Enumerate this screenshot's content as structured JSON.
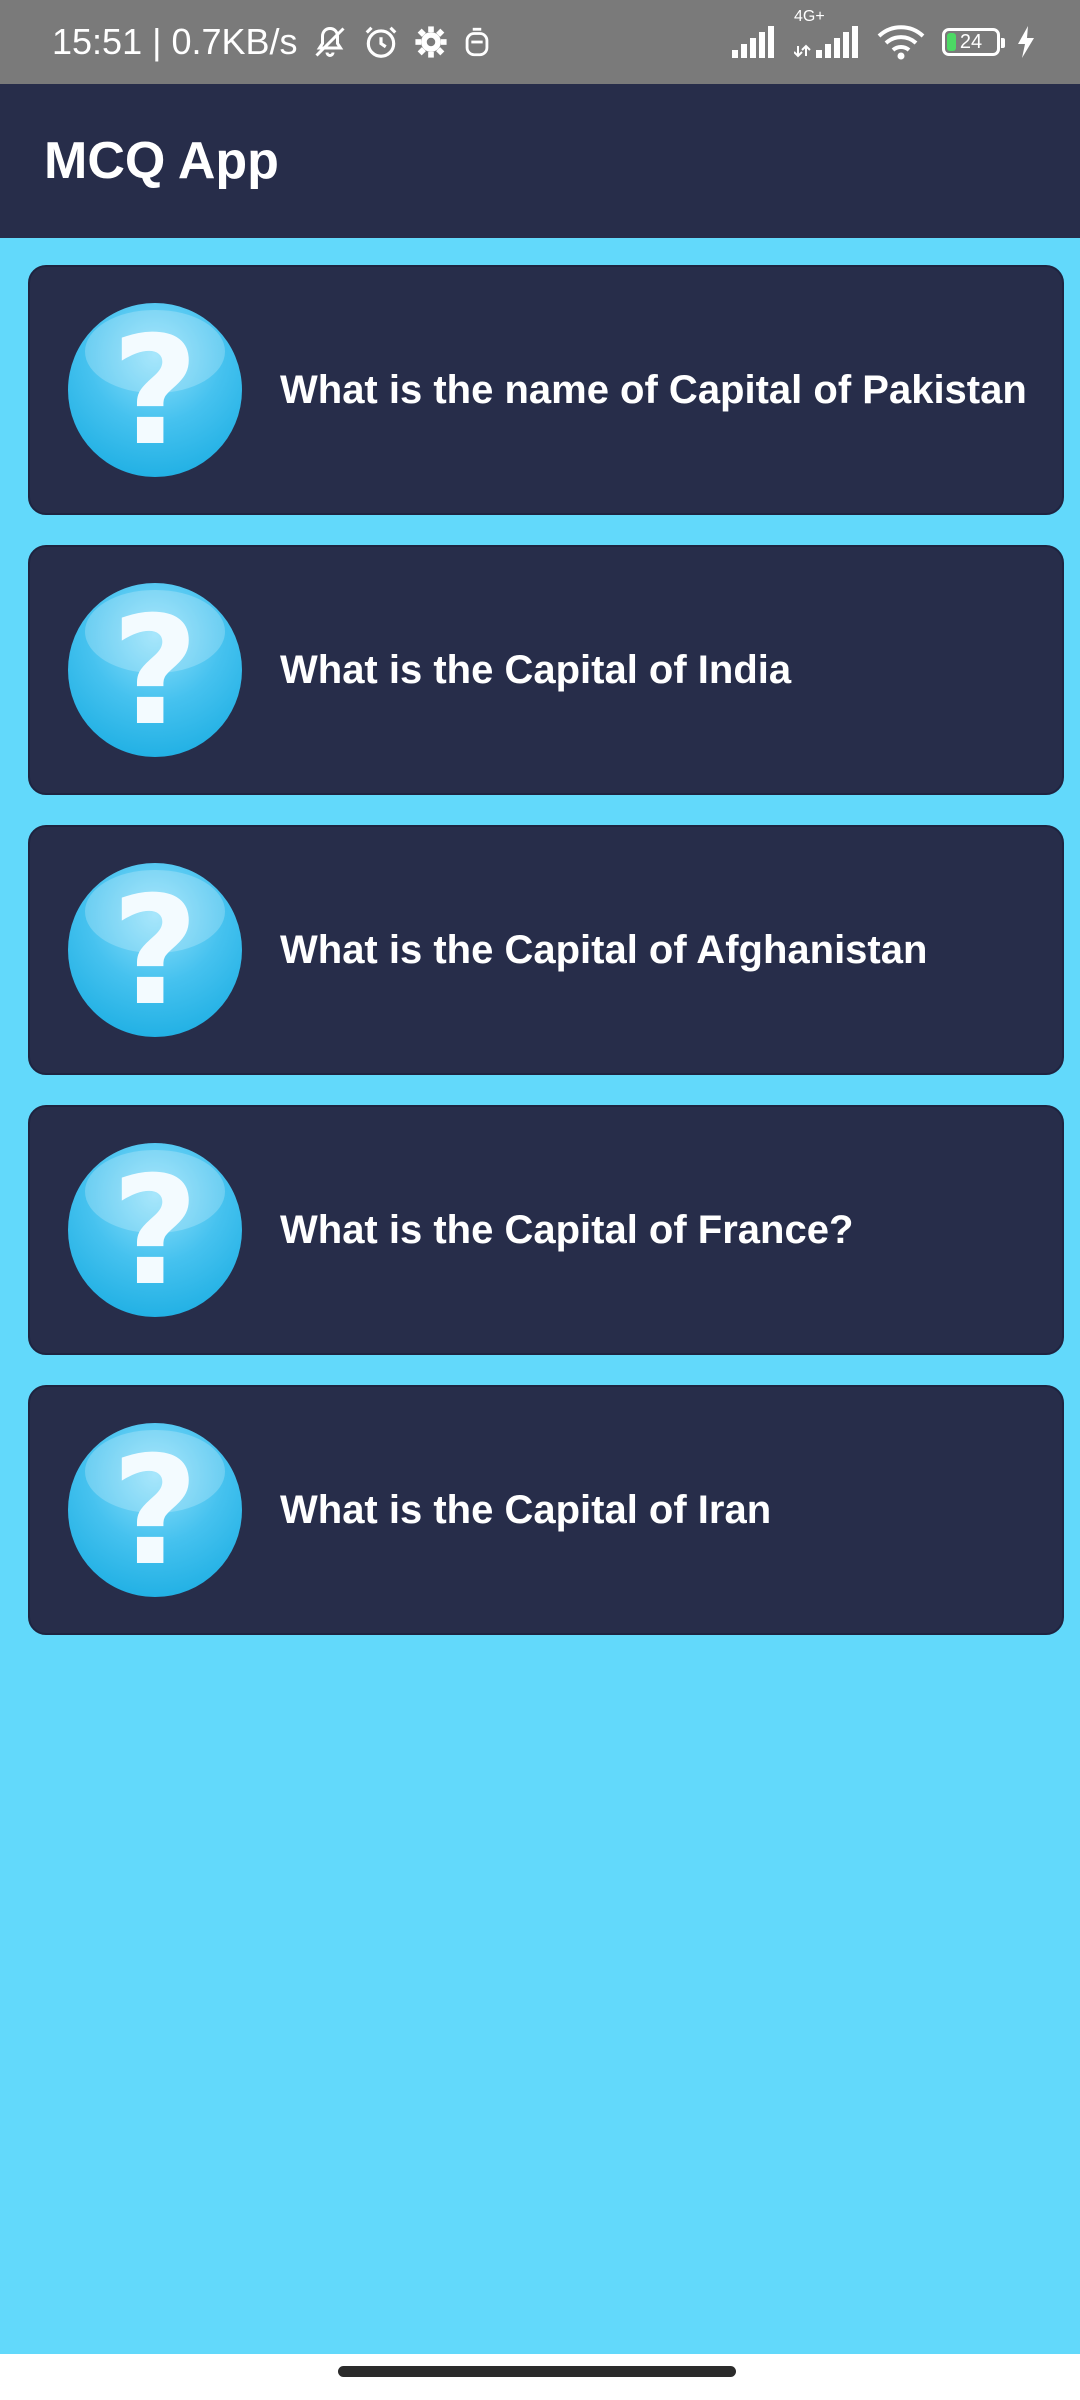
{
  "status_bar": {
    "time_speed": "15:51 | 0.7KB/s",
    "network_label": "4G+",
    "battery_level": "24",
    "icons": [
      "mute-bell-icon",
      "alarm-icon",
      "gear-icon",
      "app-notification-icon",
      "signal-icon",
      "signal-4g-icon",
      "wifi-icon",
      "battery-icon",
      "charging-icon"
    ]
  },
  "app_bar": {
    "title": "MCQ App"
  },
  "questions": [
    {
      "text": "What is the name of Capital of Pakistan",
      "icon": "question-mark-icon"
    },
    {
      "text": "What is the Capital of India",
      "icon": "question-mark-icon"
    },
    {
      "text": "What is the Capital of Afghanistan",
      "icon": "question-mark-icon"
    },
    {
      "text": "What is the Capital of France?",
      "icon": "question-mark-icon"
    },
    {
      "text": "What is the Capital of Iran",
      "icon": "question-mark-icon"
    }
  ],
  "icon_glyph": "?",
  "colors": {
    "background": "#62d9fb",
    "app_bar": "#272d4a",
    "card": "#272d4a",
    "icon_blue": "#29b6ea"
  }
}
